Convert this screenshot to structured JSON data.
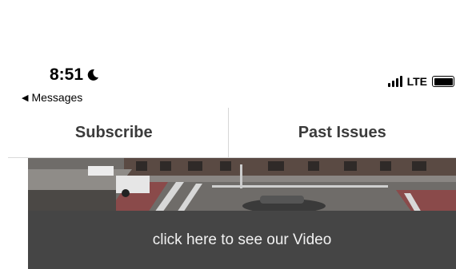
{
  "status_bar": {
    "time": "8:51",
    "moon_icon": "crescent-moon-icon",
    "back_label": "Messages",
    "network": "LTE",
    "signal_icon": "cellular-signal-icon",
    "battery_icon": "battery-icon",
    "battery_level": 1.0
  },
  "tabs": [
    {
      "label": "Subscribe"
    },
    {
      "label": "Past Issues"
    }
  ],
  "video": {
    "caption": "click here to see our Video",
    "overlay_color": "#454545"
  }
}
